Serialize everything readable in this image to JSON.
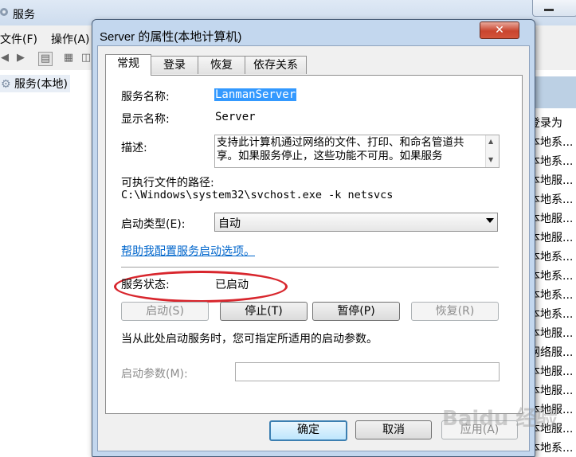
{
  "background": {
    "window_title": "服务",
    "menu": [
      "文件(F)",
      "操作(A)"
    ],
    "tree_item": "服务(本地)",
    "column_header": "登录为",
    "rows": [
      "本地系...",
      "本地系...",
      "本地服...",
      "本地系...",
      "本地服...",
      "本地服...",
      "本地系...",
      "本地系...",
      "本地系...",
      "本地系...",
      "本地服...",
      "网络服...",
      "本地服...",
      "本地服...",
      "本地服...",
      "本地服...",
      "本地系..."
    ]
  },
  "dialog": {
    "title": "Server 的属性(本地计算机)",
    "tabs": [
      "常规",
      "登录",
      "恢复",
      "依存关系"
    ],
    "active_tab": "常规",
    "service_name_label": "服务名称:",
    "service_name": "LanmanServer",
    "display_name_label": "显示名称:",
    "display_name": "Server",
    "description_label": "描述:",
    "description": "支持此计算机通过网络的文件、打印、和命名管道共享。如果服务停止，这些功能不可用。如果服务",
    "exe_path_label": "可执行文件的路径:",
    "exe_path": "C:\\Windows\\system32\\svchost.exe -k netsvcs",
    "startup_type_label": "启动类型(E):",
    "startup_type": "自动",
    "help_link": "帮助我配置服务启动选项。",
    "status_label": "服务状态:",
    "status_value": "已启动",
    "buttons": {
      "start": "启动(S)",
      "stop": "停止(T)",
      "pause": "暂停(P)",
      "resume": "恢复(R)"
    },
    "param_hint": "当从此处启动服务时，您可指定所适用的启动参数。",
    "param_label": "启动参数(M):",
    "param_value": "",
    "footer": {
      "ok": "确定",
      "cancel": "取消",
      "apply": "应用(A)"
    },
    "close_glyph": "✕"
  },
  "watermark": "Baidu 经验",
  "colors": {
    "accent_red": "#d8262d",
    "selection": "#3399ff",
    "link": "#0066cc"
  }
}
